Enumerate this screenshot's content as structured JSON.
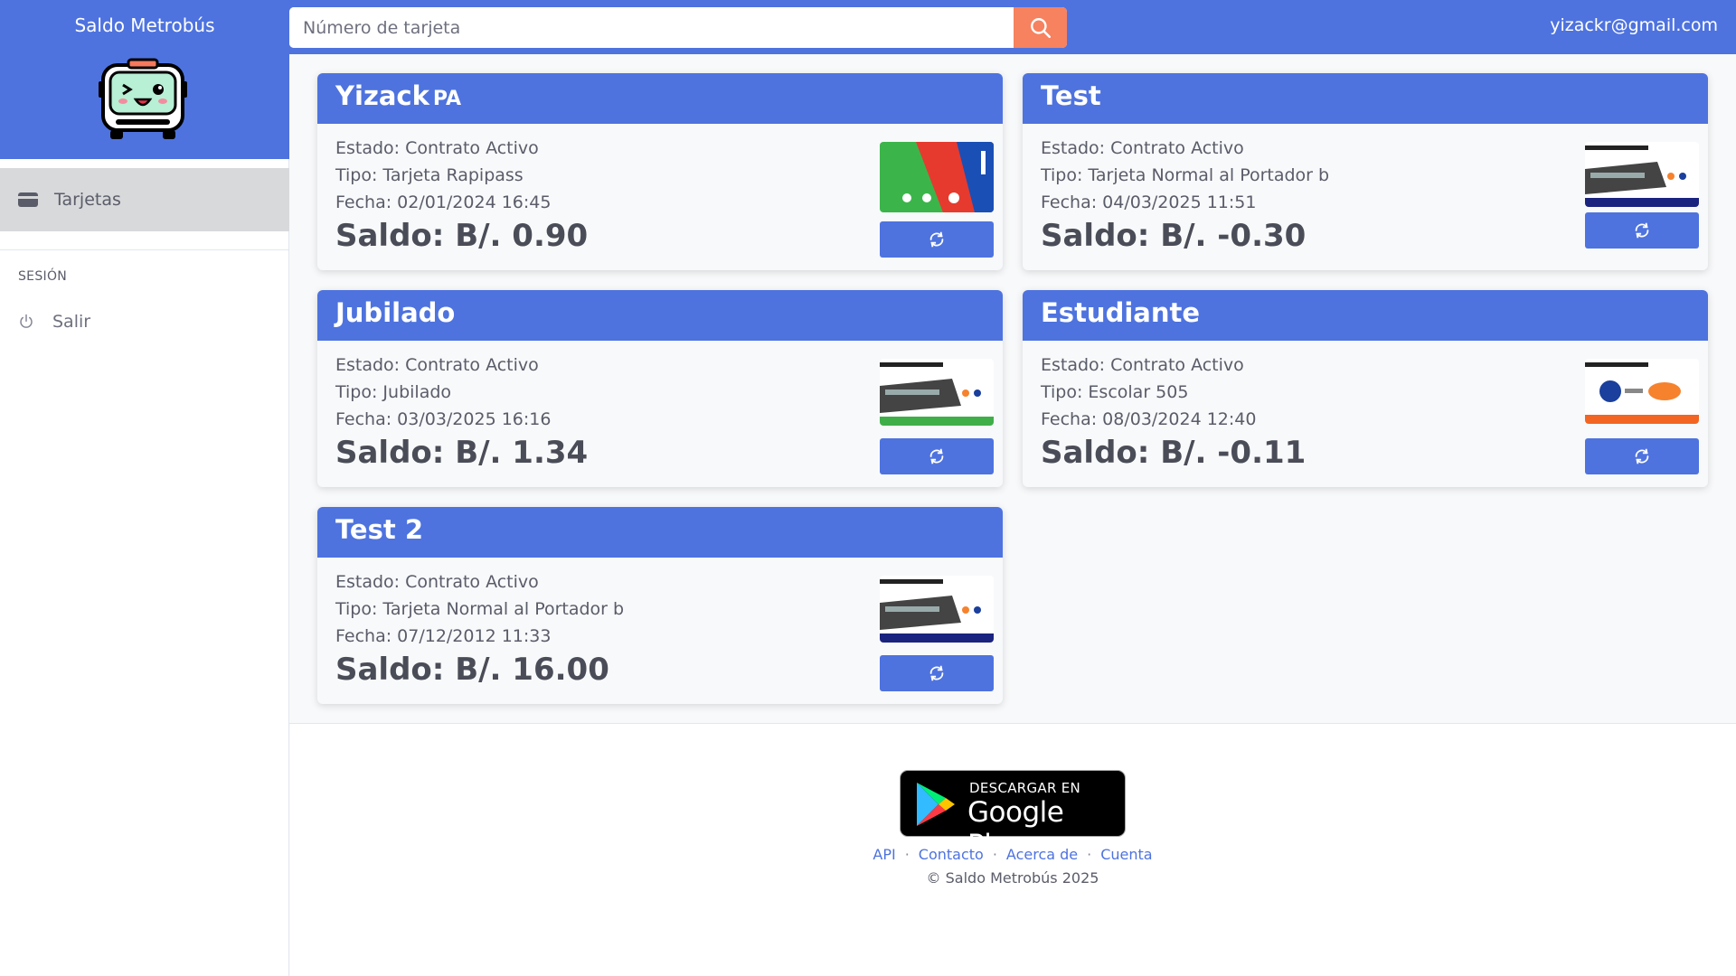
{
  "app": {
    "title": "Saldo Metrobús"
  },
  "search": {
    "placeholder": "Número de tarjeta"
  },
  "user": {
    "email": "yizackr@gmail.com"
  },
  "sidebar": {
    "active_item": "Tarjetas",
    "section_label": "SESIÓN",
    "logout_label": "Salir"
  },
  "cards": [
    {
      "name": "Yizack",
      "suffix": "PA",
      "estado": "Estado: Contrato Activo",
      "tipo": "Tipo: Tarjeta Rapipass",
      "fecha": "Fecha: 02/01/2024 16:45",
      "saldo": "Saldo: B/. 0.90",
      "image": "rapipass-card"
    },
    {
      "name": "Test",
      "suffix": "",
      "estado": "Estado: Contrato Activo",
      "tipo": "Tipo: Tarjeta Normal al Portador b",
      "fecha": "Fecha: 04/03/2025 11:51",
      "saldo": "Saldo: B/. -0.30",
      "image": "normal-card"
    },
    {
      "name": "Jubilado",
      "suffix": "",
      "estado": "Estado: Contrato Activo",
      "tipo": "Tipo: Jubilado",
      "fecha": "Fecha: 03/03/2025 16:16",
      "saldo": "Saldo: B/. 1.34",
      "image": "jubilado-card"
    },
    {
      "name": "Estudiante",
      "suffix": "",
      "estado": "Estado: Contrato Activo",
      "tipo": "Tipo: Escolar 505",
      "fecha": "Fecha: 08/03/2024 12:40",
      "saldo": "Saldo: B/. -0.11",
      "image": "escolar-card"
    },
    {
      "name": "Test 2",
      "suffix": "",
      "estado": "Estado: Contrato Activo",
      "tipo": "Tipo: Tarjeta Normal al Portador b",
      "fecha": "Fecha: 07/12/2012 11:33",
      "saldo": "Saldo: B/. 16.00",
      "image": "normal-card"
    }
  ],
  "footer": {
    "badge_small": "DESCARGAR EN",
    "badge_big": "Google Play",
    "links": [
      "API",
      "Contacto",
      "Acerca de",
      "Cuenta"
    ],
    "copyright": "© Saldo Metrobús 2025"
  },
  "colors": {
    "primary": "#4e73df",
    "search_button": "#f6825f",
    "sidebar_active": "#d8d9db"
  }
}
